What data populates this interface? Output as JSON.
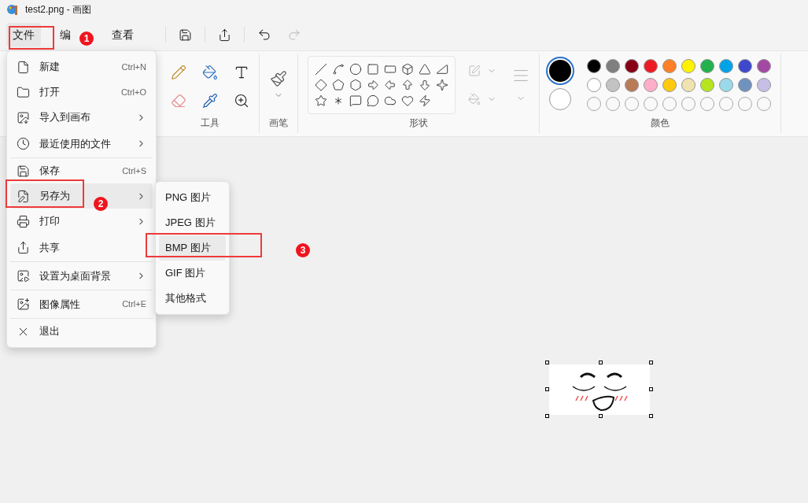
{
  "window": {
    "title": "test2.png - 画图"
  },
  "menubar": [
    {
      "label": "文件",
      "selected": true
    },
    {
      "label": "编",
      "selected": false
    },
    {
      "label": "查看",
      "selected": false
    }
  ],
  "ribbon": {
    "groups": [
      {
        "kind": "tools",
        "label": "工具"
      },
      {
        "kind": "brushes",
        "label": "画笔"
      },
      {
        "kind": "shapes",
        "label": "形状"
      },
      {
        "kind": "colors",
        "label": "颜色"
      }
    ],
    "current_colors": [
      {
        "color": "#000000",
        "selected": true
      },
      {
        "color": "#ffffff",
        "selected": false
      }
    ],
    "palette": [
      {
        "color": "#000000"
      },
      {
        "color": "#7f7f7f"
      },
      {
        "color": "#880015"
      },
      {
        "color": "#ed1c24"
      },
      {
        "color": "#ff7f27"
      },
      {
        "color": "#fff200"
      },
      {
        "color": "#22b14c"
      },
      {
        "color": "#00a2e8"
      },
      {
        "color": "#3f48cc"
      },
      {
        "color": "#a349a4"
      },
      {
        "color": "#ffffff"
      },
      {
        "color": "#c3c3c3"
      },
      {
        "color": "#b97a57"
      },
      {
        "color": "#ffaec9"
      },
      {
        "color": "#ffc90e"
      },
      {
        "color": "#efe4b0"
      },
      {
        "color": "#b5e61d"
      },
      {
        "color": "#99d9ea"
      },
      {
        "color": "#7092be"
      },
      {
        "color": "#c8bfe7"
      }
    ]
  },
  "file_menu": {
    "items": [
      {
        "kind": "new",
        "label": "新建",
        "shortcut": "Ctrl+N",
        "submenu": false,
        "selected": false
      },
      {
        "kind": "open",
        "label": "打开",
        "shortcut": "Ctrl+O",
        "submenu": false,
        "selected": false
      },
      {
        "kind": "import",
        "label": "导入到画布",
        "submenu": true,
        "selected": false
      },
      {
        "kind": "recent",
        "label": "最近使用的文件",
        "submenu": true,
        "selected": false,
        "divider": true
      },
      {
        "kind": "save",
        "label": "保存",
        "shortcut": "Ctrl+S",
        "submenu": false,
        "selected": false
      },
      {
        "kind": "saveas",
        "label": "另存为",
        "submenu": true,
        "selected": true
      },
      {
        "kind": "print",
        "label": "打印",
        "submenu": true,
        "selected": false
      },
      {
        "kind": "share",
        "label": "共享",
        "submenu": false,
        "selected": false,
        "divider": true
      },
      {
        "kind": "wallpaper",
        "label": "设置为桌面背景",
        "submenu": true,
        "selected": false,
        "divider": true
      },
      {
        "kind": "properties",
        "label": "图像属性",
        "shortcut": "Ctrl+E",
        "submenu": false,
        "selected": false,
        "divider": true
      },
      {
        "kind": "exit",
        "label": "退出",
        "submenu": false,
        "selected": false
      }
    ]
  },
  "save_as_menu": {
    "items": [
      {
        "label": "PNG 图片",
        "selected": false
      },
      {
        "label": "JPEG 图片",
        "selected": false
      },
      {
        "label": "BMP 图片",
        "selected": true
      },
      {
        "label": "GIF 图片",
        "selected": false
      },
      {
        "label": "其他格式",
        "selected": false
      }
    ]
  },
  "annotations": [
    "1",
    "2",
    "3"
  ]
}
